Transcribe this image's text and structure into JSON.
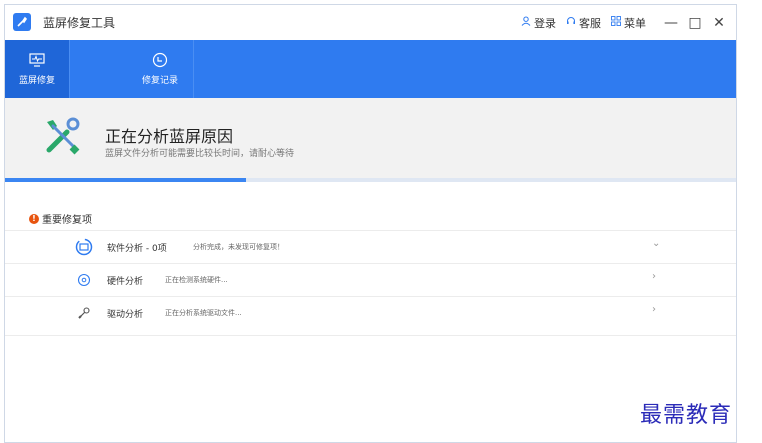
{
  "app": {
    "title": "蓝屏修复工具"
  },
  "titlebar": {
    "login": "登录",
    "support": "客服",
    "menu": "菜单",
    "minimize": "—",
    "maximize": "□",
    "close": "✕"
  },
  "nav": {
    "items": [
      {
        "label": "蓝屏修复",
        "icon": "monitor-pulse-icon",
        "active": true
      },
      {
        "label": "修复记录",
        "icon": "record-shield-icon",
        "active": false
      }
    ]
  },
  "header": {
    "title": "正在分析蓝屏原因",
    "subtitle": "蓝屏文件分析可能需要比较长时间，请耐心等待",
    "icon": "tools-icon"
  },
  "progress": {
    "value": 0.33
  },
  "section": {
    "title": "重要修复项",
    "icon": "warning-icon"
  },
  "items": [
    {
      "label": "软件分析 - 0项",
      "status": "分析完成，未发现可修复项！",
      "icon": "software-icon",
      "chevron": "⌄"
    },
    {
      "label": "硬件分析",
      "status": "正在检测系统硬件...",
      "icon": "hardware-icon",
      "chevron": "›"
    },
    {
      "label": "驱动分析",
      "status": "正在分析系统驱动文件...",
      "icon": "driver-icon",
      "chevron": "›"
    }
  ],
  "watermark": "最需教育",
  "colors": {
    "accent": "#2f7bf0",
    "warning": "#e8540f"
  }
}
